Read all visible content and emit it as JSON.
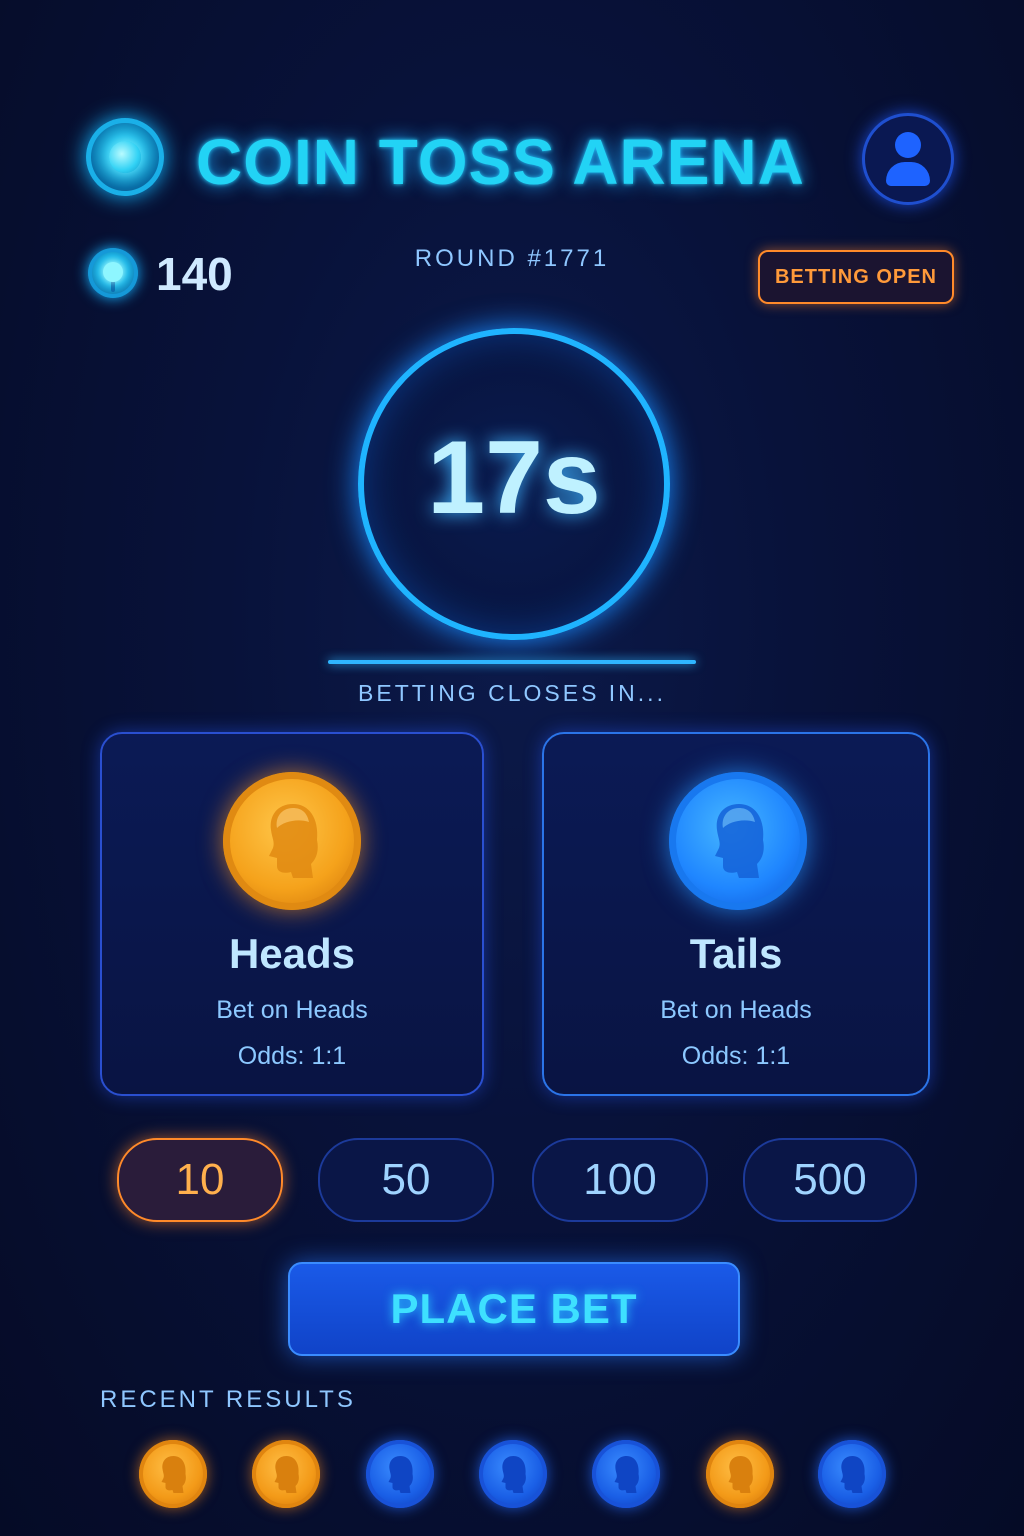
{
  "header": {
    "title": "COIN TOSS ARENA",
    "logo_icon": "coin-icon",
    "avatar_icon": "user-icon"
  },
  "status": {
    "balance": "140",
    "round": "ROUND #1771",
    "badge": "BETTING OPEN"
  },
  "timer": {
    "value": "17s",
    "progress": 1.0,
    "caption": "BETTING CLOSES IN..."
  },
  "options": [
    {
      "title": "Heads",
      "subtitle": "Bet on Heads",
      "odds": "Odds: 1:1",
      "color": "#f5a21b"
    },
    {
      "title": "Tails",
      "subtitle": "Bet on Heads",
      "odds": "Odds: 1:1",
      "color": "#1f86ff"
    }
  ],
  "chips": [
    {
      "label": "10",
      "selected": true
    },
    {
      "label": "50",
      "selected": false
    },
    {
      "label": "100",
      "selected": false
    },
    {
      "label": "500",
      "selected": false
    }
  ],
  "action": {
    "place_bet": "PLACE BET"
  },
  "recent": {
    "label": "RECENT RESULTS",
    "results": [
      "heads",
      "heads",
      "tails",
      "tails",
      "tails",
      "heads",
      "tails"
    ]
  },
  "colors": {
    "accent": "#22d3f5",
    "heads": "#f5a21b",
    "tails": "#1f86ff",
    "active": "#ff8a2a"
  }
}
